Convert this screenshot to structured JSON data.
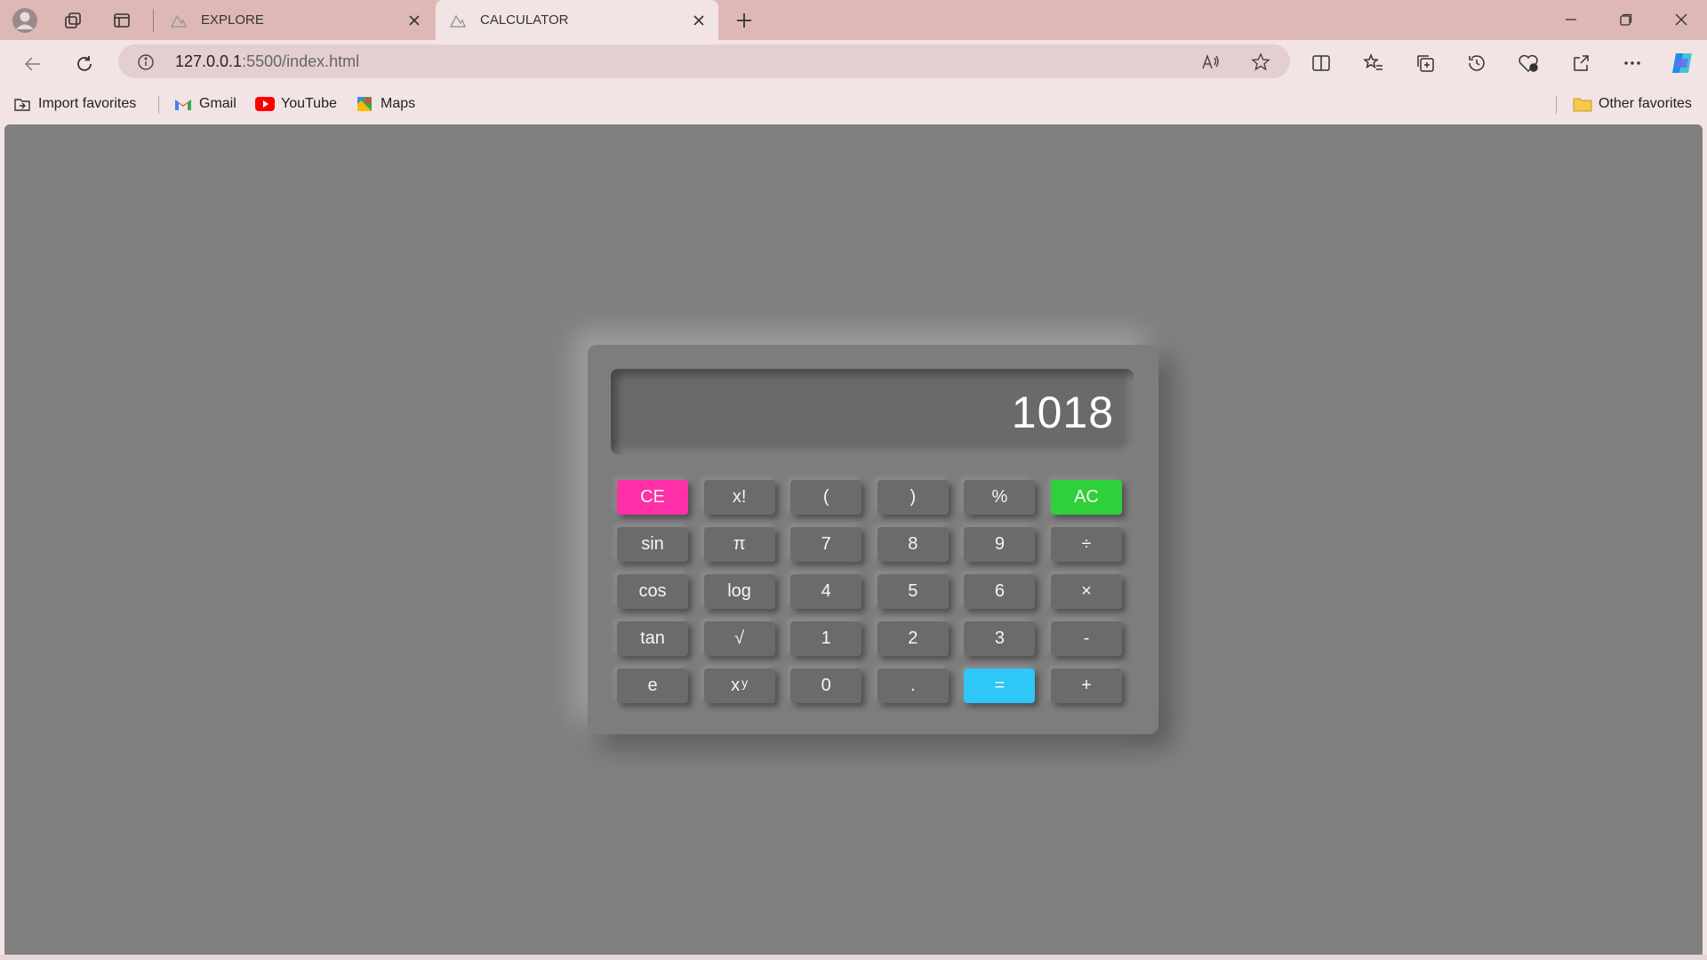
{
  "browser": {
    "tabs": [
      {
        "title": "EXPLORE",
        "active": false
      },
      {
        "title": "CALCULATOR",
        "active": true
      }
    ],
    "address": {
      "host": "127.0.0.1",
      "rest": ":5500/index.html"
    },
    "bookmarks": {
      "import": "Import favorites",
      "items": [
        {
          "label": "Gmail",
          "icon": "gmail-icon"
        },
        {
          "label": "YouTube",
          "icon": "youtube-icon"
        },
        {
          "label": "Maps",
          "icon": "maps-icon"
        }
      ],
      "other": "Other favorites"
    }
  },
  "calculator": {
    "display": "1018",
    "keys": [
      {
        "label": "CE",
        "kind": "ce"
      },
      {
        "label": "x!",
        "kind": "fn"
      },
      {
        "label": "(",
        "kind": "op"
      },
      {
        "label": ")",
        "kind": "op"
      },
      {
        "label": "%",
        "kind": "op"
      },
      {
        "label": "AC",
        "kind": "ac"
      },
      {
        "label": "sin",
        "kind": "fn"
      },
      {
        "label": "π",
        "kind": "fn"
      },
      {
        "label": "7",
        "kind": "digit"
      },
      {
        "label": "8",
        "kind": "digit"
      },
      {
        "label": "9",
        "kind": "digit"
      },
      {
        "label": "÷",
        "kind": "op"
      },
      {
        "label": "cos",
        "kind": "fn"
      },
      {
        "label": "log",
        "kind": "fn"
      },
      {
        "label": "4",
        "kind": "digit"
      },
      {
        "label": "5",
        "kind": "digit"
      },
      {
        "label": "6",
        "kind": "digit"
      },
      {
        "label": "×",
        "kind": "op"
      },
      {
        "label": "tan",
        "kind": "fn"
      },
      {
        "label": "√",
        "kind": "fn"
      },
      {
        "label": "1",
        "kind": "digit"
      },
      {
        "label": "2",
        "kind": "digit"
      },
      {
        "label": "3",
        "kind": "digit"
      },
      {
        "label": "-",
        "kind": "op"
      },
      {
        "label": "e",
        "kind": "fn"
      },
      {
        "label": "x",
        "sup": "y",
        "kind": "fn"
      },
      {
        "label": "0",
        "kind": "digit"
      },
      {
        "label": ".",
        "kind": "digit"
      },
      {
        "label": "=",
        "kind": "eq"
      },
      {
        "label": "+",
        "kind": "op"
      }
    ]
  },
  "colors": {
    "ce": "#ff2fa7",
    "ac": "#2fd13a",
    "equals": "#2fc6f8",
    "page_bg": "#808080",
    "chrome_bg": "#deb8b5"
  }
}
